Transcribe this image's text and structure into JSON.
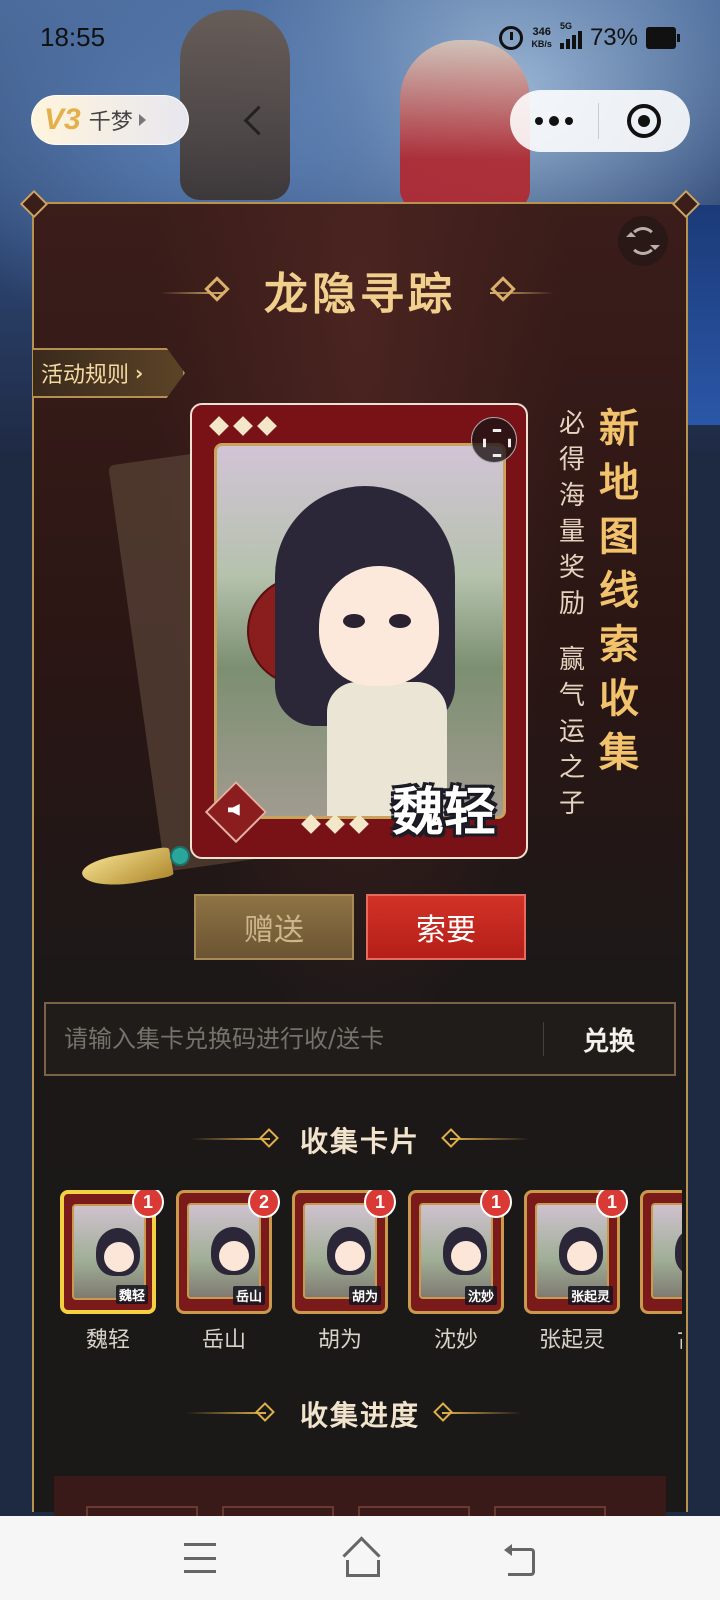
{
  "status_bar": {
    "time": "18:55",
    "net_speed_value": "346",
    "net_speed_unit": "KB/s",
    "network_type": "5G",
    "battery_percent": "73%"
  },
  "mini_program": {
    "vip_level": "V3",
    "user_name": "千梦"
  },
  "event": {
    "title": "龙隐寻踪",
    "rules_button": "活动规则",
    "slogan_main": "新地图线索收集",
    "slogan_sub_1": "必得海量奖励",
    "slogan_sub_2": "赢气运之子"
  },
  "featured_card": {
    "name": "魏轻"
  },
  "actions": {
    "gift_label": "赠送",
    "request_label": "索要"
  },
  "redeem": {
    "placeholder": "请输入集卡兑换码进行收/送卡",
    "button_label": "兑换"
  },
  "collect_section": {
    "title": "收集卡片",
    "cards": [
      {
        "name": "魏轻",
        "label": "魏轻",
        "count": "1",
        "active": true
      },
      {
        "name": "岳山",
        "label": "岳山",
        "count": "2",
        "active": false
      },
      {
        "name": "胡为",
        "label": "胡为",
        "count": "1",
        "active": false
      },
      {
        "name": "沈妙",
        "label": "沈妙",
        "count": "1",
        "active": false
      },
      {
        "name": "张起灵",
        "label": "张起灵",
        "count": "1",
        "active": false
      },
      {
        "name": "古",
        "label": "",
        "count": "",
        "active": false
      }
    ]
  },
  "progress_section": {
    "title": "收集进度"
  },
  "icons": {
    "alarm": "alarm-icon",
    "signal": "signal-icon",
    "battery": "battery-icon",
    "back": "chevron-left-icon",
    "more": "more-icon",
    "close_mini": "target-icon",
    "refresh": "refresh-icon",
    "expand": "fullscreen-icon",
    "sound": "speaker-icon"
  },
  "colors": {
    "accent_gold": "#f1cf8c",
    "request_red": "#c8261f",
    "badge_red": "#d93a36"
  }
}
